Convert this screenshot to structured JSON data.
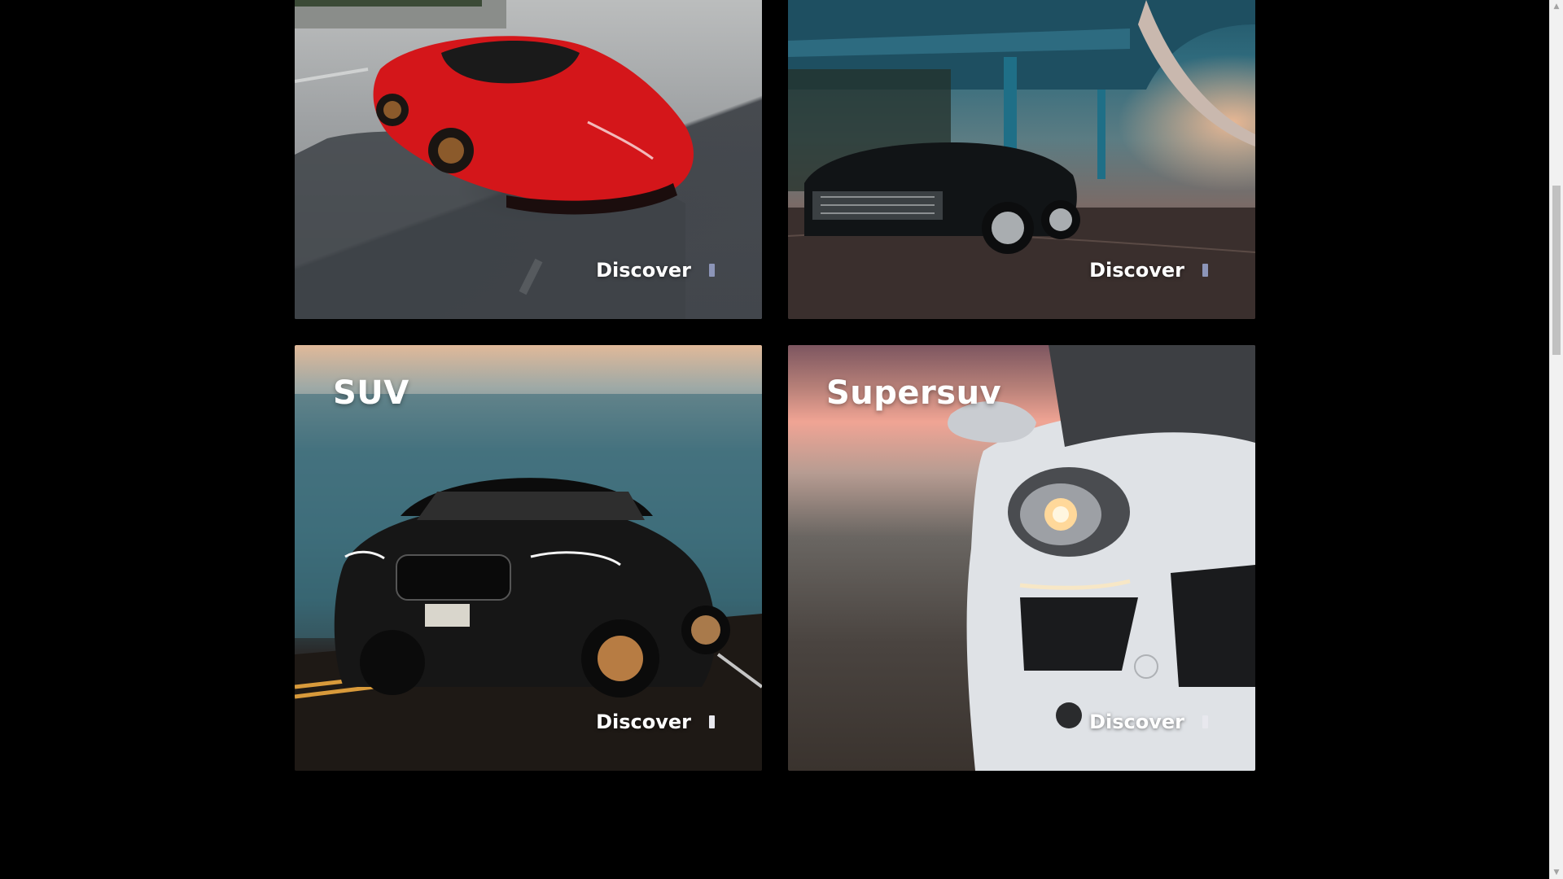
{
  "cards": [
    {
      "title": "",
      "discover_label": "Discover"
    },
    {
      "title": "",
      "discover_label": "Discover"
    },
    {
      "title": "SUV",
      "discover_label": "Discover"
    },
    {
      "title": "Supersuv",
      "discover_label": "Discover"
    }
  ],
  "scrollbar": {
    "up_glyph": "▲",
    "down_glyph": "▼"
  },
  "colors": {
    "page_background": "#000000",
    "text": "#ffffff",
    "discover_bar": "#e8e8ee"
  },
  "icons": {
    "discover": "arrow-bar-icon"
  }
}
